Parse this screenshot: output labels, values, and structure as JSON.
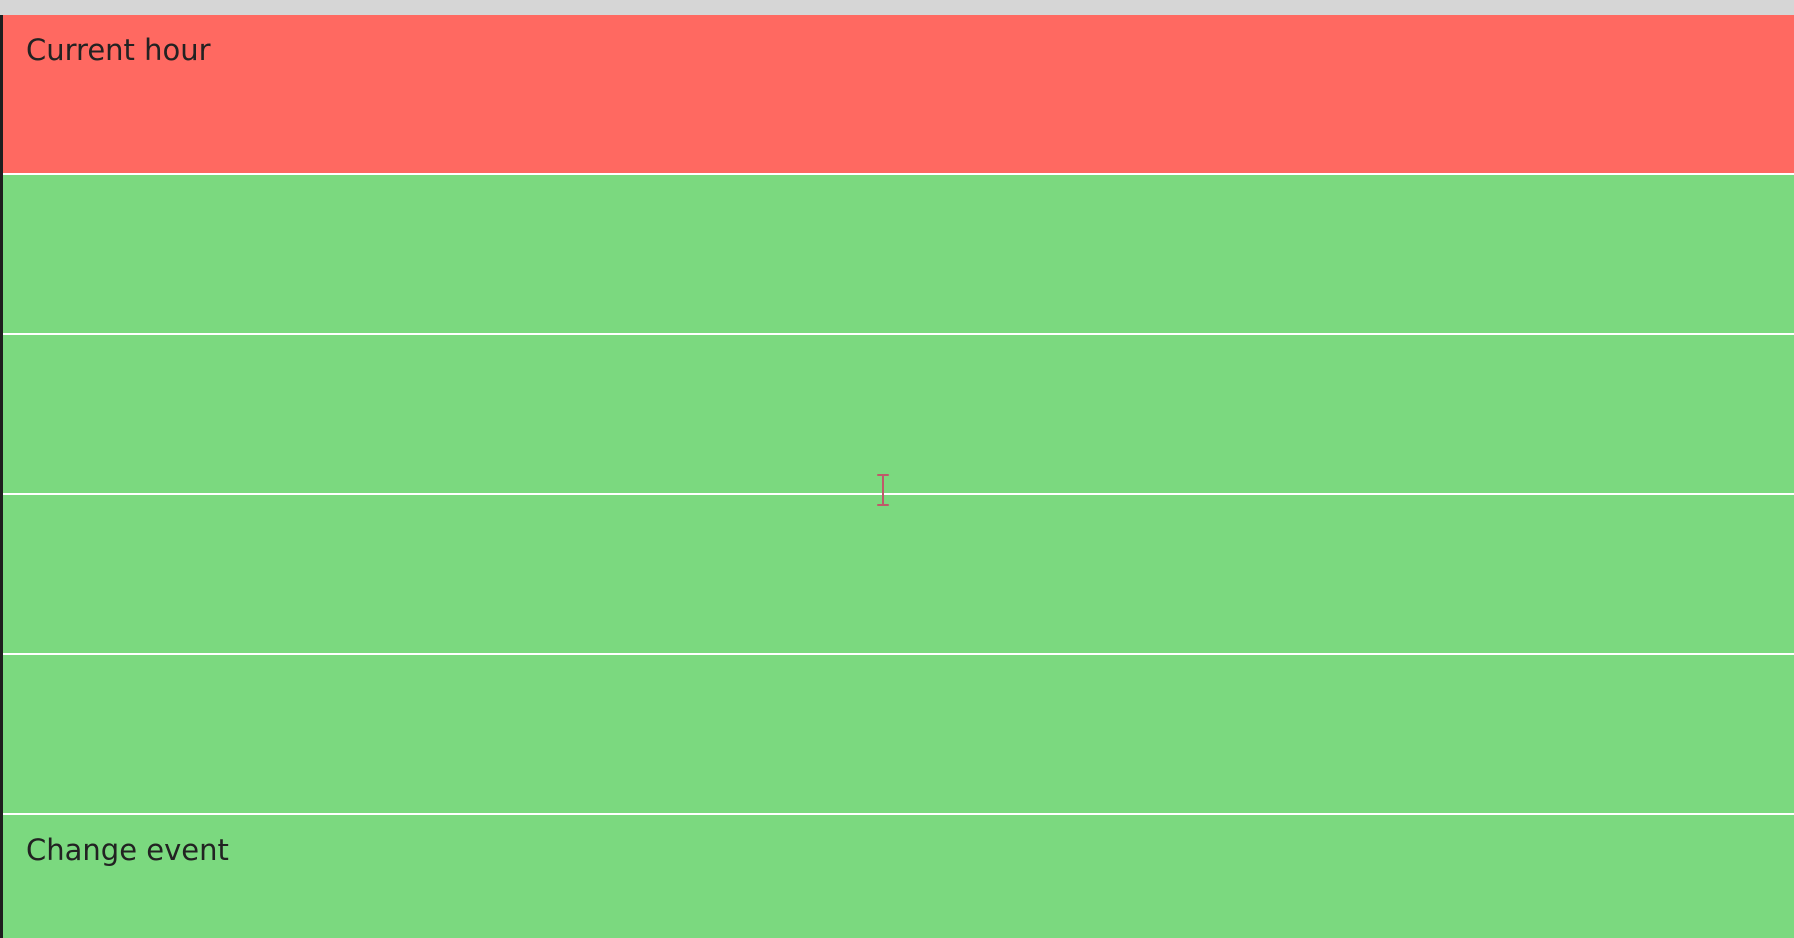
{
  "colors": {
    "past_row": "#ff6961",
    "future_row": "#7bd97f",
    "divider": "#ffffff",
    "top_bar": "#d6d6d6"
  },
  "rows": [
    {
      "status": "past",
      "text": "Current hour"
    },
    {
      "status": "future",
      "text": ""
    },
    {
      "status": "future",
      "text": ""
    },
    {
      "status": "future",
      "text": ""
    },
    {
      "status": "future",
      "text": ""
    },
    {
      "status": "future",
      "text": "Change event"
    }
  ],
  "cursor_icon": "text-cursor-icon"
}
